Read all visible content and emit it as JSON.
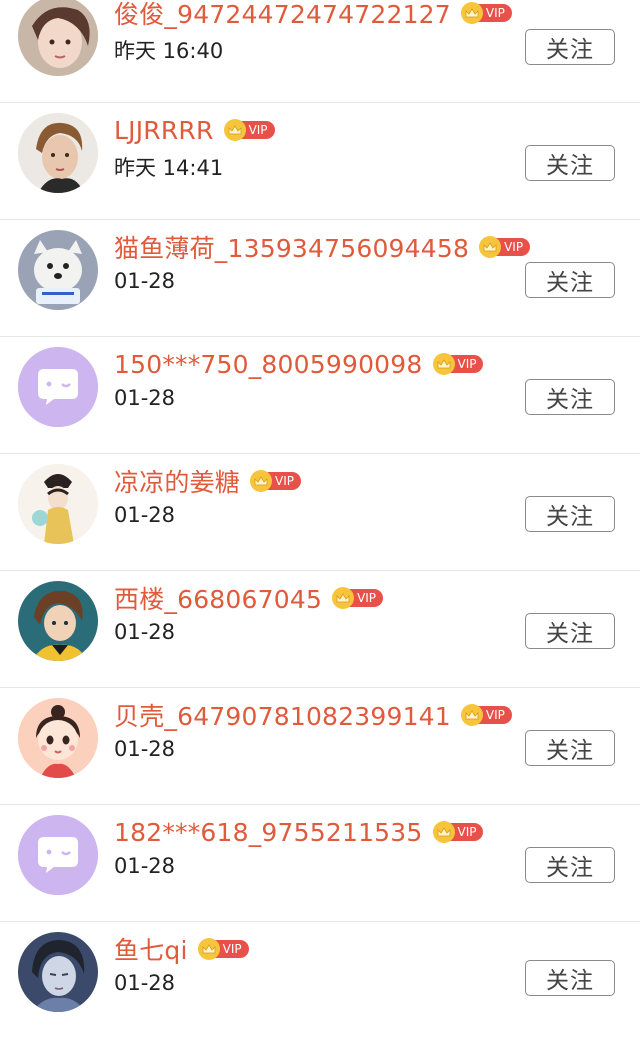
{
  "follow_label": "关注",
  "vip_label": "VIP",
  "colors": {
    "name": "#e05a3c",
    "vip_badge": "#e8514a",
    "crown": "#f6c53c",
    "button_border": "#8a8a8a",
    "default_avatar": "#cdb5f0"
  },
  "users": [
    {
      "name": "俊俊_94724472474722127",
      "time": "昨天 16:40",
      "avatar": "photo-girl-avatar"
    },
    {
      "name": "LJJRRRR",
      "time": "昨天 14:41",
      "avatar": "photo-woman-avatar"
    },
    {
      "name": "猫鱼薄荷_135934756094458",
      "time": "01-28",
      "avatar": "photo-dog-avatar"
    },
    {
      "name": "150***750_8005990098",
      "time": "01-28",
      "avatar": "default-chat-avatar"
    },
    {
      "name": "凉凉的姜糖",
      "time": "01-28",
      "avatar": "illustrated-lady-avatar"
    },
    {
      "name": "西楼_668067045",
      "time": "01-28",
      "avatar": "anime-boy-avatar"
    },
    {
      "name": "贝壳_64790781082399141",
      "time": "01-28",
      "avatar": "cartoon-girl-avatar"
    },
    {
      "name": "182***618_9755211535",
      "time": "01-28",
      "avatar": "default-chat-avatar"
    },
    {
      "name": "鱼七qi",
      "time": "01-28",
      "avatar": "anime-man-avatar"
    }
  ]
}
